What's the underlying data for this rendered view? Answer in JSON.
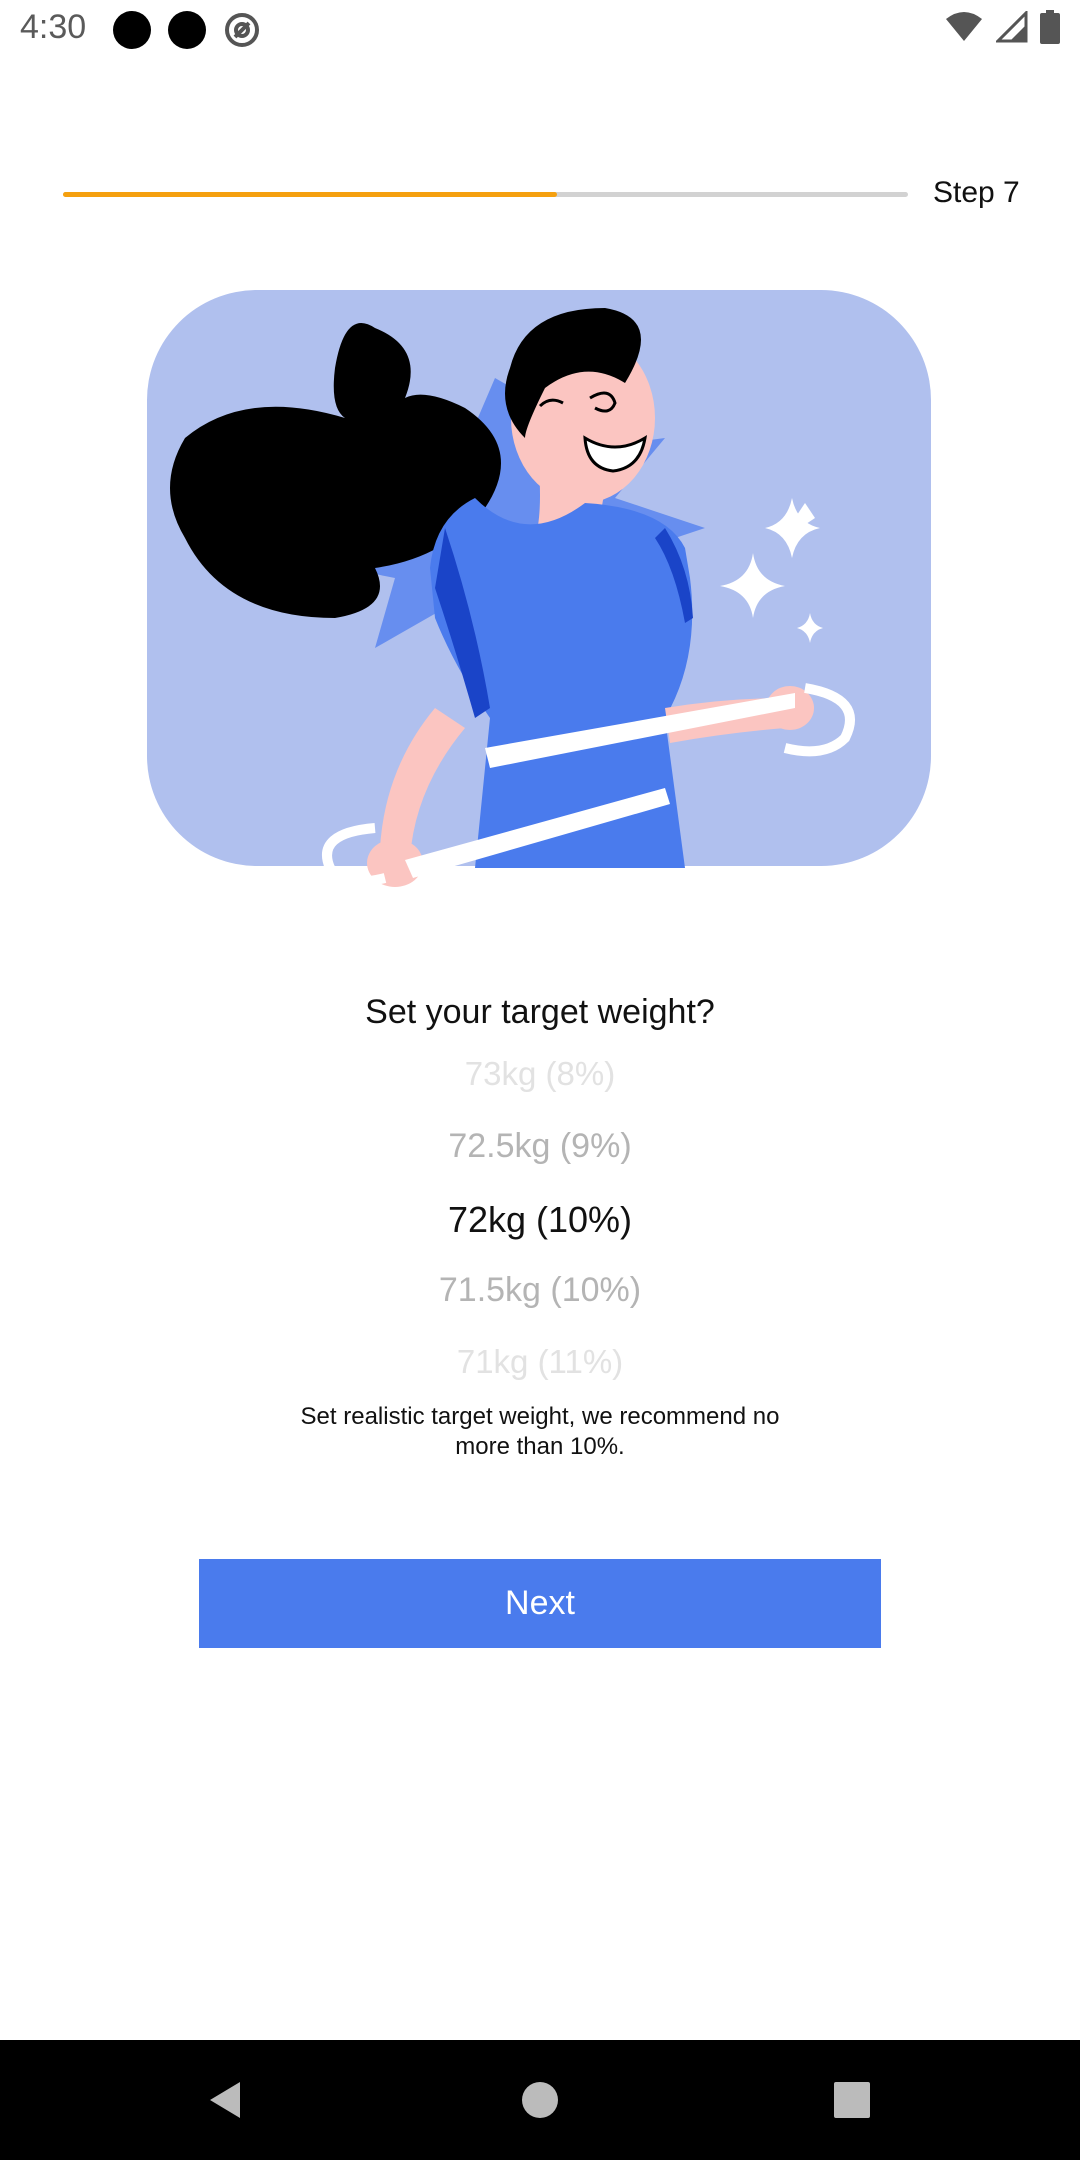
{
  "status_bar": {
    "time": "4:30",
    "icons": [
      "notification-dot-icon",
      "notification-dot-icon",
      "at-sign-icon",
      "wifi-icon",
      "signal-icon",
      "battery-icon"
    ]
  },
  "progress": {
    "fraction": 0.585,
    "step_label": "Step 7",
    "fill_color": "#f5a00f",
    "track_color": "#d2d2d2"
  },
  "illustration": {
    "subject": "woman measuring waist with tape",
    "background_color": "#b0c0ee",
    "accent_color": "#4a7bed"
  },
  "question": "Set your target weight?",
  "picker": {
    "options": [
      "73kg (8%)",
      "72.5kg (9%)",
      "72kg (10%)",
      "71.5kg (10%)",
      "71kg (11%)"
    ],
    "selected": "72kg (10%)"
  },
  "hint": "Set realistic target weight, we recommend no more than 10%.",
  "next_button": {
    "label": "Next",
    "color": "#4a7bed"
  },
  "nav_bar": {
    "buttons": [
      "back-icon",
      "home-icon",
      "recents-icon"
    ]
  }
}
